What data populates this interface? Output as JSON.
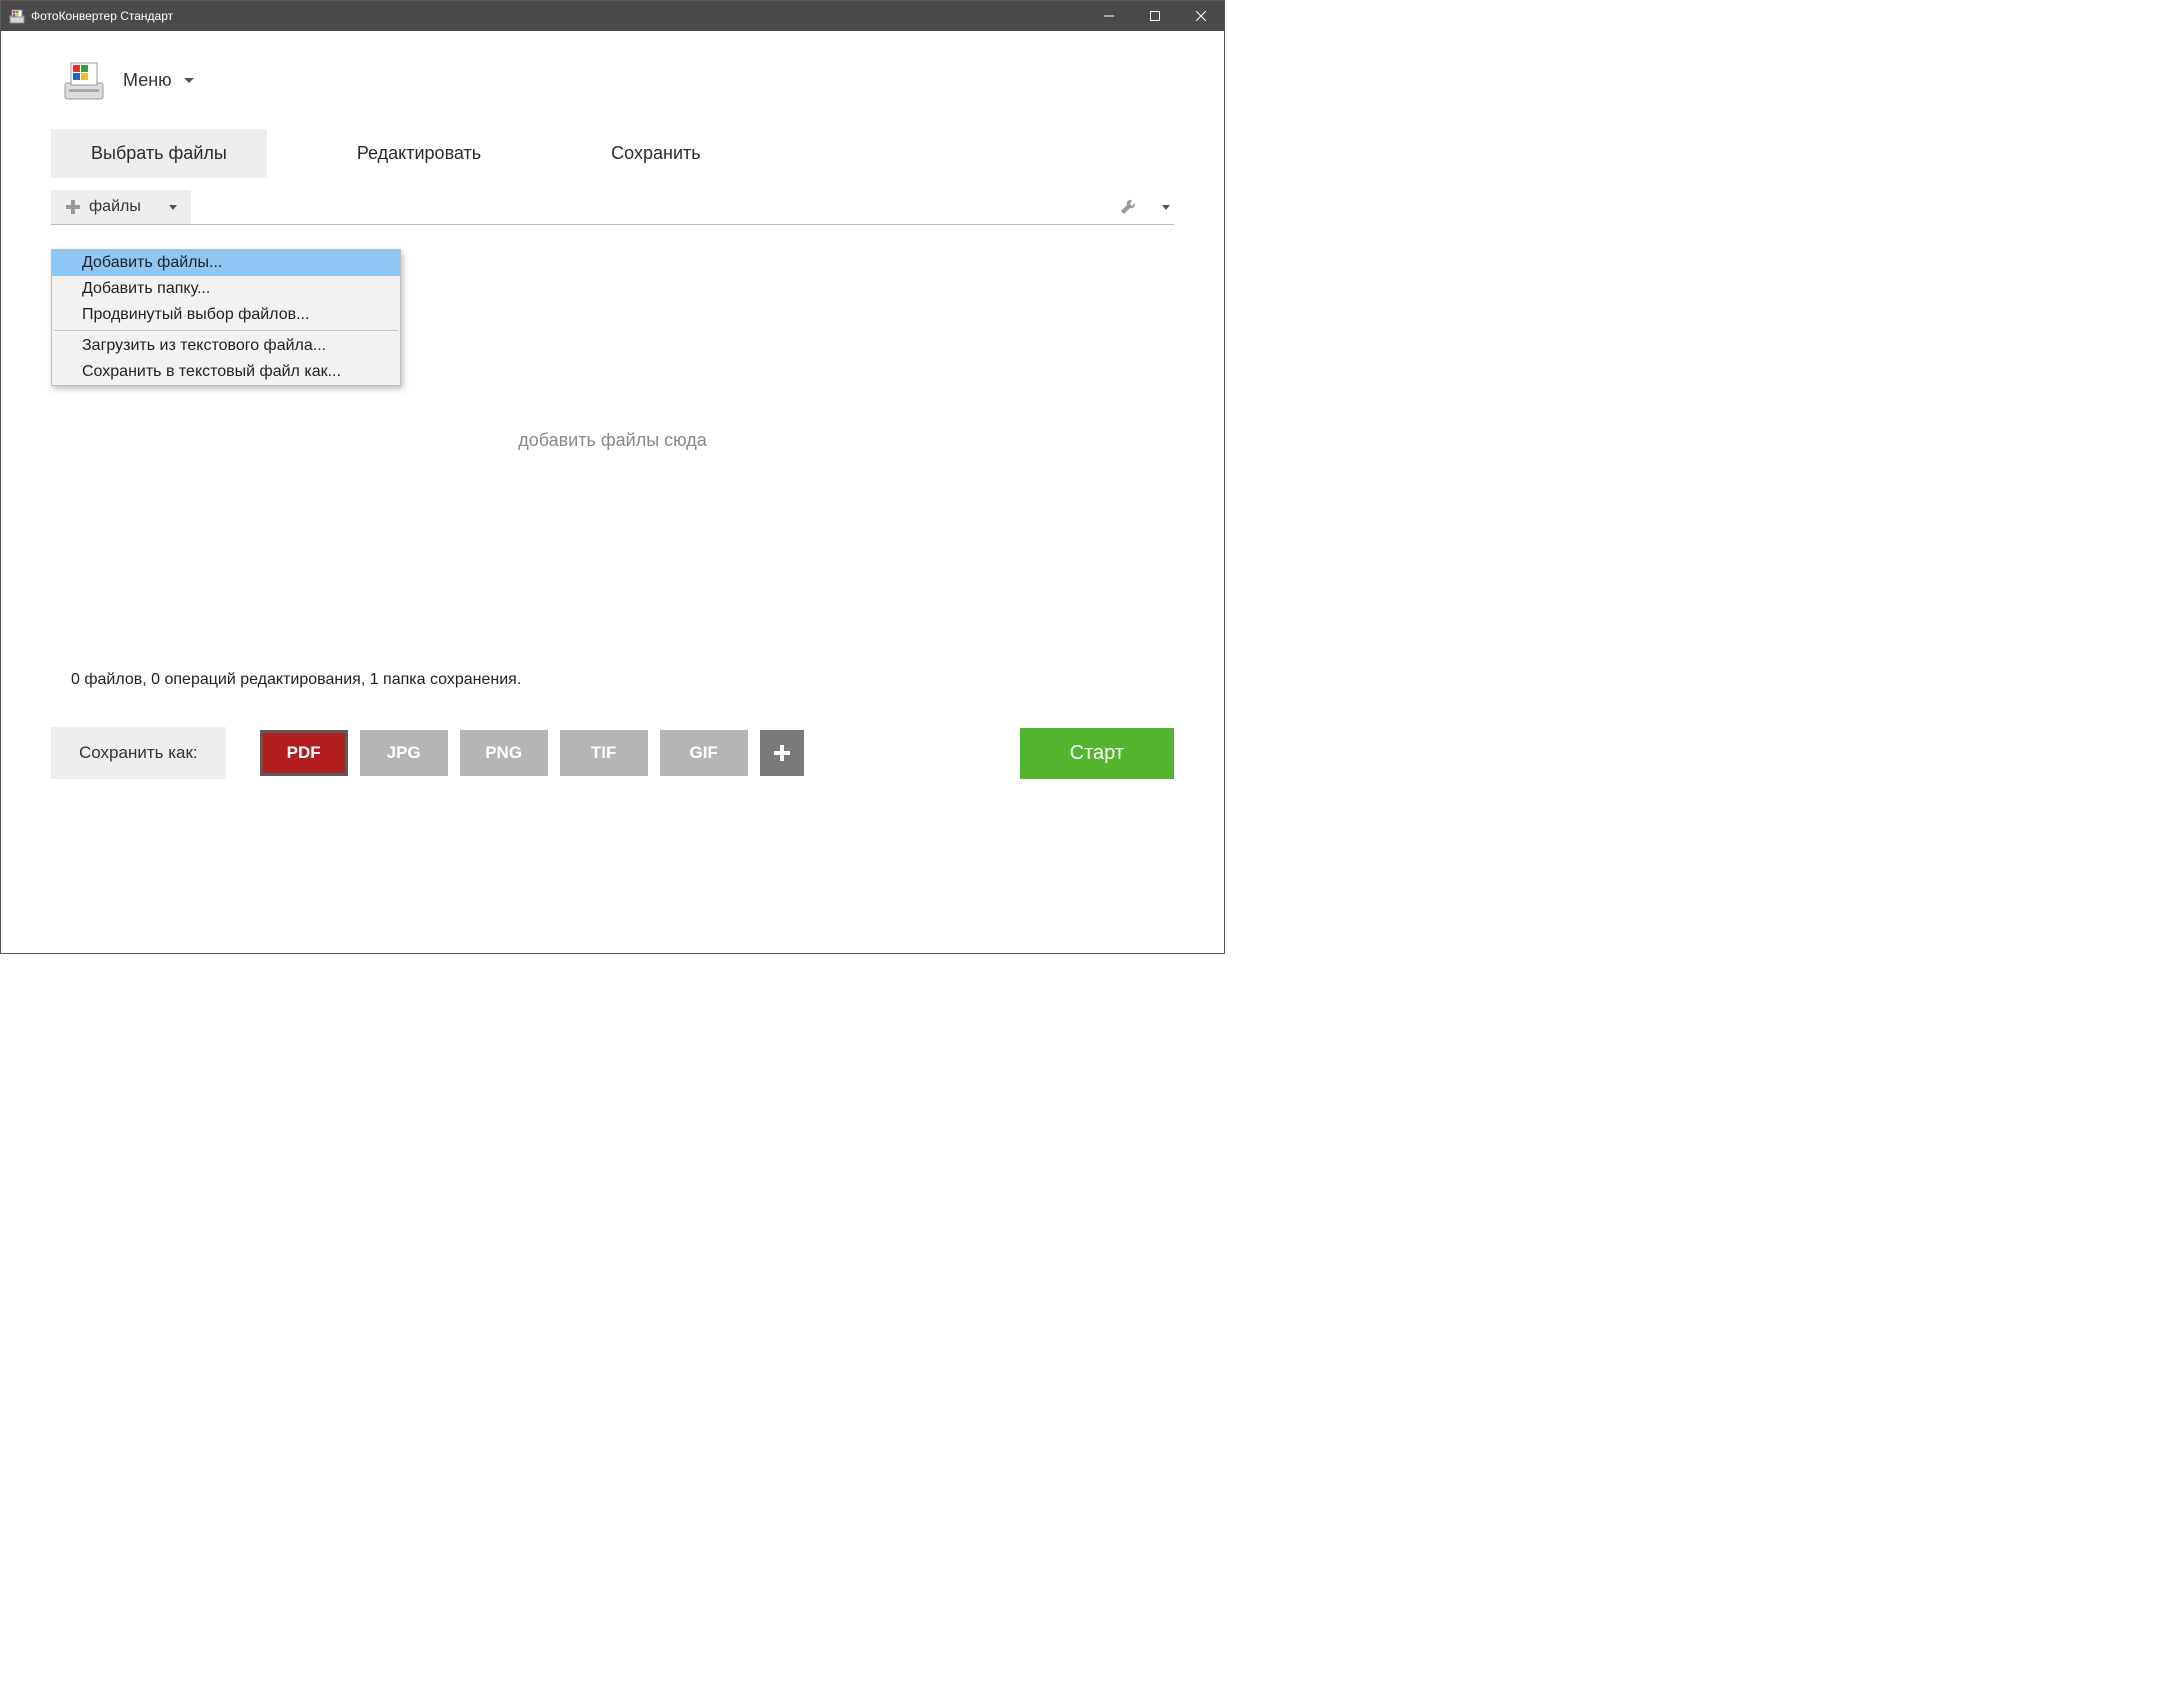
{
  "titlebar": {
    "title": "ФотоКонвертер Стандарт"
  },
  "menu": {
    "label": "Меню"
  },
  "tabs": {
    "select": "Выбрать файлы",
    "edit": "Редактировать",
    "save": "Сохранить"
  },
  "files_button": {
    "label": "файлы"
  },
  "dropdown": {
    "add_files": "Добавить файлы...",
    "add_folder": "Добавить папку...",
    "advanced": "Продвинутый выбор файлов...",
    "load_text": "Загрузить из текстового файла...",
    "save_text": "Сохранить в текстовый файл как..."
  },
  "drop_hint": "добавить файлы сюда",
  "status": "0 файлов, 0 операций редактирования, 1 папка сохранения.",
  "save_as_label": "Сохранить как:",
  "formats": {
    "pdf": "PDF",
    "jpg": "JPG",
    "png": "PNG",
    "tif": "TIF",
    "gif": "GIF"
  },
  "start": "Старт"
}
